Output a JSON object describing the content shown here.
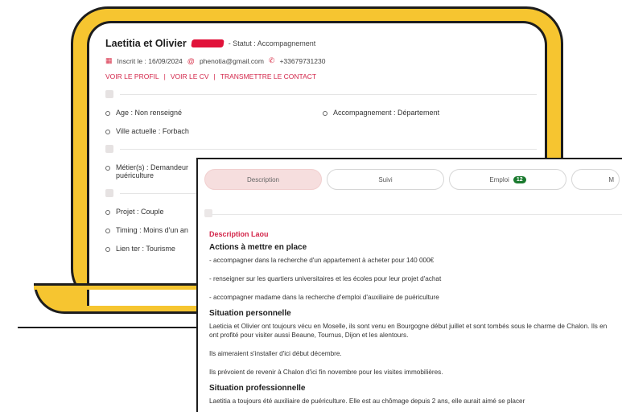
{
  "profile": {
    "name": "Laetitia et Olivier",
    "status": "- Statut : Accompagnement",
    "registered": "Inscrit le : 16/09/2024",
    "email": "phenotia@gmail.com",
    "phone": "+33679731230",
    "links": [
      "VOIR LE PROFIL",
      "VOIR LE CV",
      "TRANSMETTRE LE CONTACT"
    ],
    "separator": "|",
    "fields": {
      "age": "Age : Non renseigné",
      "accompagnement": "Accompagnement : Département",
      "ville": "Ville actuelle : Forbach",
      "metier_line1": "Métier(s) : Demandeur",
      "metier_line2": "puériculture",
      "projet": "Projet : Couple",
      "timing": "Timing : Moins d'un an",
      "lien": "Lien ter : Tourisme"
    }
  },
  "card": {
    "tabs": [
      {
        "label": "Description",
        "active": true
      },
      {
        "label": "Suivi",
        "active": false
      },
      {
        "label": "Emploi",
        "badge": "12",
        "active": false
      },
      {
        "label": "M",
        "active": false
      }
    ],
    "subtitle": "Description Laou",
    "sections": [
      {
        "title": "Actions à mettre en place",
        "paragraphs": [
          "- accompagner dans la recherche d'un appartement à acheter pour 140 000€",
          "- renseigner sur les quartiers universitaires et les écoles pour leur projet d'achat",
          "- accompagner madame dans la recherche d'emploi d'auxiliaire de puériculture"
        ]
      },
      {
        "title": "Situation personnelle",
        "paragraphs": [
          "Laeticia et Olivier ont toujours vécu en Moselle, ils sont venu en Bourgogne début juillet et sont tombés sous le charme de Chalon. Ils en ont profité pour visiter aussi Beaune, Tournus, Dijon et les alentours.",
          "Ils aimeraient s'installer d'ici début décembre.",
          "Ils prévoient de revenir à Chalon d'ici fin novembre pour les visites immobilières."
        ]
      },
      {
        "title": "Situation professionnelle",
        "paragraphs": [
          "Laetitia a toujours été auxiliaire de puériculture. Elle est au chômage depuis 2 ans, elle aurait aimé se placer"
        ]
      }
    ]
  },
  "colors": {
    "accent": "#d3264a",
    "frame": "#f6c530",
    "outline": "#1d1d1d",
    "badge": "#1a7a2e"
  }
}
